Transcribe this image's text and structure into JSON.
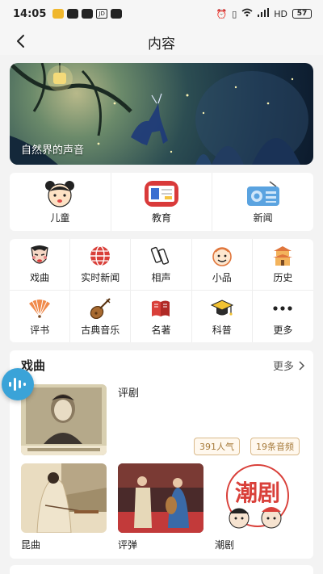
{
  "status": {
    "time": "14:05",
    "network": "HD",
    "battery": "57"
  },
  "nav": {
    "title": "内容"
  },
  "banner": {
    "title": "自然界的声音"
  },
  "top_categories": [
    {
      "label": "儿童",
      "icon": "child-face-icon"
    },
    {
      "label": "教育",
      "icon": "education-board-icon"
    },
    {
      "label": "新闻",
      "icon": "radio-icon"
    }
  ],
  "grid_categories": [
    {
      "label": "戏曲",
      "icon": "opera-mask-icon"
    },
    {
      "label": "实时新闻",
      "icon": "globe-icon"
    },
    {
      "label": "相声",
      "icon": "fan-slips-icon"
    },
    {
      "label": "小品",
      "icon": "smiley-face-icon"
    },
    {
      "label": "历史",
      "icon": "pagoda-icon"
    },
    {
      "label": "评书",
      "icon": "folding-fan-icon"
    },
    {
      "label": "古典音乐",
      "icon": "pipa-icon"
    },
    {
      "label": "名著",
      "icon": "book-icon"
    },
    {
      "label": "科普",
      "icon": "graduation-cap-icon"
    },
    {
      "label": "更多",
      "icon": "more-dots-icon"
    }
  ],
  "section": {
    "title": "戏曲",
    "more_label": "更多",
    "featured": {
      "name": "评剧",
      "popularity": "391人气",
      "audio_count": "19条音频"
    },
    "tiles": [
      {
        "label": "昆曲"
      },
      {
        "label": "评弹"
      },
      {
        "label": "潮剧",
        "logo_text": "潮剧"
      }
    ]
  },
  "colors": {
    "accent": "#3aa3d8",
    "tag": "#a67a3a",
    "background": "#f3f3f3"
  }
}
